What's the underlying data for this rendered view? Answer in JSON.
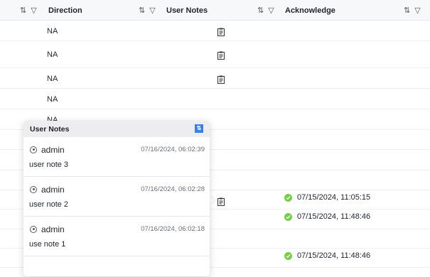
{
  "header": {
    "columns": [
      {
        "label": ""
      },
      {
        "label": "Direction"
      },
      {
        "label": "User Notes"
      },
      {
        "label": "Acknowledge"
      }
    ],
    "sort_icon": "sort-icon",
    "filter_icon": "filter-icon"
  },
  "rows": [
    {
      "direction": "NA",
      "has_note": true,
      "ack": ""
    },
    {
      "direction": "NA",
      "has_note": true,
      "ack": ""
    },
    {
      "direction": "NA",
      "has_note": true,
      "ack": ""
    },
    {
      "direction": "NA",
      "has_note": false,
      "ack": ""
    },
    {
      "direction": "NA",
      "has_note": false,
      "ack": ""
    },
    {
      "direction": "",
      "has_note": false,
      "ack": ""
    },
    {
      "direction": "",
      "has_note": false,
      "ack": ""
    },
    {
      "direction": "",
      "has_note": false,
      "ack": ""
    },
    {
      "direction": "",
      "has_note": true,
      "ack": "07/15/2024, 11:05:15"
    },
    {
      "direction": "",
      "has_note": false,
      "ack": "07/15/2024, 11:48:46"
    },
    {
      "direction": "",
      "has_note": false,
      "ack": ""
    },
    {
      "direction": "",
      "has_note": false,
      "ack": "07/15/2024, 11:48:46"
    }
  ],
  "popup": {
    "title": "User Notes",
    "notes": [
      {
        "user": "admin",
        "time": "07/16/2024, 06:02:39",
        "text": "user note 3"
      },
      {
        "user": "admin",
        "time": "07/16/2024, 06:02:28",
        "text": "user note 2"
      },
      {
        "user": "admin",
        "time": "07/16/2024, 06:02:18",
        "text": "use note 1"
      }
    ]
  },
  "colors": {
    "accent": "#3a7ee6",
    "success": "#52c41a"
  }
}
